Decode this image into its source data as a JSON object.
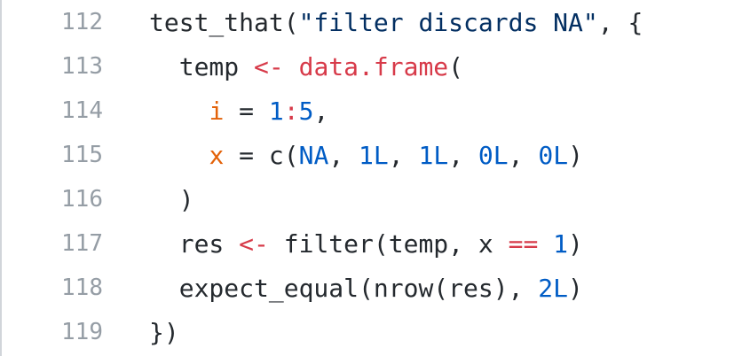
{
  "lines": [
    {
      "number": "112",
      "indent": "",
      "tokens": [
        {
          "text": "test_that(",
          "type": "plain"
        },
        {
          "text": "\"filter discards NA\"",
          "type": "str"
        },
        {
          "text": ", {",
          "type": "plain"
        }
      ]
    },
    {
      "number": "113",
      "indent": "  ",
      "tokens": [
        {
          "text": "temp ",
          "type": "plain"
        },
        {
          "text": "<-",
          "type": "kw"
        },
        {
          "text": " ",
          "type": "plain"
        },
        {
          "text": "data.frame",
          "type": "fn"
        },
        {
          "text": "(",
          "type": "plain"
        }
      ]
    },
    {
      "number": "114",
      "indent": "    ",
      "tokens": [
        {
          "text": "i",
          "type": "arg"
        },
        {
          "text": " = ",
          "type": "plain"
        },
        {
          "text": "1",
          "type": "num"
        },
        {
          "text": ":",
          "type": "kw"
        },
        {
          "text": "5",
          "type": "num"
        },
        {
          "text": ",",
          "type": "plain"
        }
      ]
    },
    {
      "number": "115",
      "indent": "    ",
      "tokens": [
        {
          "text": "x",
          "type": "arg"
        },
        {
          "text": " = c(",
          "type": "plain"
        },
        {
          "text": "NA",
          "type": "const"
        },
        {
          "text": ", ",
          "type": "plain"
        },
        {
          "text": "1L",
          "type": "num"
        },
        {
          "text": ", ",
          "type": "plain"
        },
        {
          "text": "1L",
          "type": "num"
        },
        {
          "text": ", ",
          "type": "plain"
        },
        {
          "text": "0L",
          "type": "num"
        },
        {
          "text": ", ",
          "type": "plain"
        },
        {
          "text": "0L",
          "type": "num"
        },
        {
          "text": ")",
          "type": "plain"
        }
      ]
    },
    {
      "number": "116",
      "indent": "  ",
      "tokens": [
        {
          "text": ")",
          "type": "plain"
        }
      ]
    },
    {
      "number": "117",
      "indent": "  ",
      "tokens": [
        {
          "text": "res ",
          "type": "plain"
        },
        {
          "text": "<-",
          "type": "kw"
        },
        {
          "text": " filter(temp, x ",
          "type": "plain"
        },
        {
          "text": "==",
          "type": "kw"
        },
        {
          "text": " ",
          "type": "plain"
        },
        {
          "text": "1",
          "type": "num"
        },
        {
          "text": ")",
          "type": "plain"
        }
      ]
    },
    {
      "number": "118",
      "indent": "  ",
      "tokens": [
        {
          "text": "expect_equal(nrow(res), ",
          "type": "plain"
        },
        {
          "text": "2L",
          "type": "num"
        },
        {
          "text": ")",
          "type": "plain"
        }
      ]
    },
    {
      "number": "119",
      "indent": "",
      "tokens": [
        {
          "text": "})",
          "type": "plain"
        }
      ]
    }
  ],
  "colors": {
    "plain": "#24292e",
    "string": "#032f62",
    "keyword": "#d73a49",
    "argument": "#e36209",
    "number": "#005cc5",
    "line_number": "#959da5",
    "border": "#d1d5da"
  }
}
